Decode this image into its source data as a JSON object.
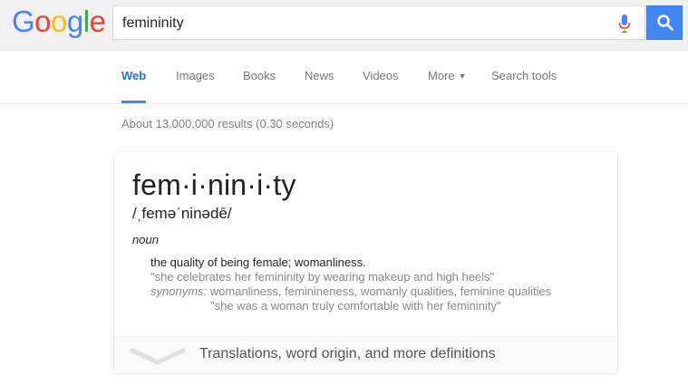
{
  "logo": {
    "letters": [
      "G",
      "o",
      "o",
      "g",
      "l",
      "e"
    ],
    "colors": [
      "#4285f4",
      "#ea4335",
      "#fbbc05",
      "#4285f4",
      "#34a853",
      "#ea4335"
    ]
  },
  "search": {
    "query": "femininity"
  },
  "tabs": [
    {
      "label": "Web",
      "active": true
    },
    {
      "label": "Images"
    },
    {
      "label": "Books"
    },
    {
      "label": "News"
    },
    {
      "label": "Videos"
    },
    {
      "label": "More"
    },
    {
      "label": "Search tools"
    }
  ],
  "results": {
    "stats": "About 13,000,000 results (0.30 seconds)"
  },
  "dictionary": {
    "word": "fem·i·nin·i·ty",
    "phonetic": "/ˌfeməˈninədē/",
    "part_of_speech": "noun",
    "definition": "the quality of being female; womanliness.",
    "example": "\"she celebrates her femininity by wearing makeup and high heels\"",
    "synonyms_label": "synonyms:",
    "synonyms": "womanliness, feminineness, womanly qualities, feminine qualities",
    "synonym_example": "\"she was a woman truly comfortable with her femininity\"",
    "more_link": "Translations, word origin, and more definitions"
  },
  "colors": {
    "accent": "#4285f4",
    "tab_active": "#1a73e8"
  }
}
